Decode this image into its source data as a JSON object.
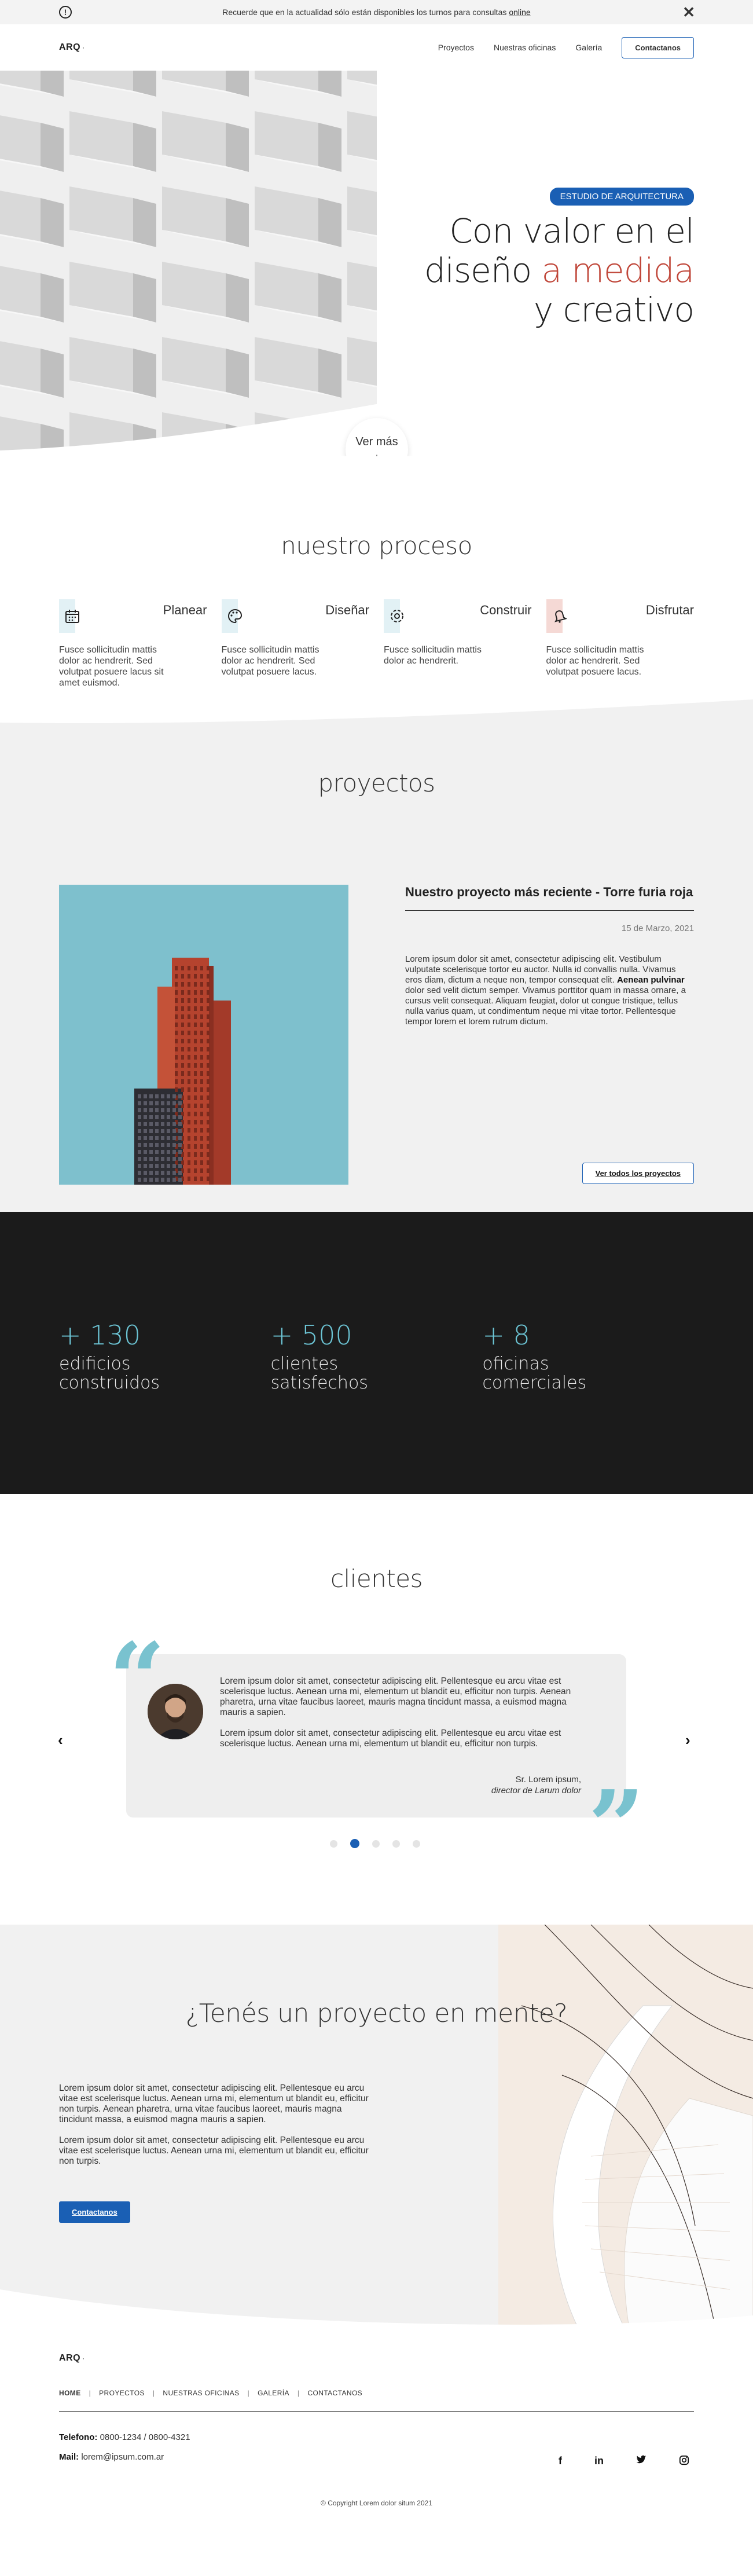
{
  "notice": {
    "icon": "alert-circle-icon",
    "text": "Recuerde que en la actualidad sólo están disponibles los turnos para consultas",
    "link": "online",
    "close": "✕"
  },
  "header": {
    "logo": "ARQ",
    "logo_mark": "·",
    "nav": [
      "Proyectos",
      "Nuestras oficinas",
      "Galería"
    ],
    "contact_button": "Contactanos"
  },
  "hero": {
    "tag": "ESTUDIO DE ARQUITECTURA",
    "line1": "Con valor en el",
    "line2_plain": "diseño",
    "line2_accent": "a medida",
    "line3": "y creativo",
    "scroll_label": "Ver más",
    "scroll_arrow": "↓"
  },
  "process": {
    "title": "nuestro proceso",
    "steps": [
      {
        "name": "Planear",
        "icon": "calendar-icon",
        "color": "#d9eef3",
        "desc": "Fusce sollicitudin mattis dolor ac hendrerit. Sed volutpat posuere lacus sit amet euismod."
      },
      {
        "name": "Diseñar",
        "icon": "palette-icon",
        "color": "#d9eef3",
        "desc": "Fusce sollicitudin mattis dolor ac hendrerit. Sed volutpat posuere lacus."
      },
      {
        "name": "Construir",
        "icon": "gear-icon",
        "color": "#d9eef3",
        "desc": "Fusce sollicitudin mattis dolor ac hendrerit."
      },
      {
        "name": "Disfrutar",
        "icon": "bell-icon",
        "color": "#f3d6d2",
        "desc": "Fusce sollicitudin mattis dolor ac hendrerit. Sed volutpat posuere lacus."
      }
    ]
  },
  "projects": {
    "title": "proyectos",
    "project_title": "Nuestro proyecto más reciente - Torre furia roja",
    "date": "15 de Marzo, 2021",
    "desc_a": "Lorem ipsum dolor sit amet, consectetur adipiscing elit. Vestibulum vulputate scelerisque tortor eu auctor. Nulla id convallis nulla. Vivamus eros diam, dictum a neque non, tempor consequat elit.",
    "desc_bold": "Aenean pulvinar",
    "desc_b": "dolor sed velit dictum semper. Vivamus porttitor quam in massa ornare, a cursus velit consequat. Aliquam feugiat, dolor ut congue tristique, tellus nulla varius quam, ut condimentum neque mi vitae tortor. Pellentesque tempor lorem et lorem rutrum dictum.",
    "button": "Ver todos los proyectos"
  },
  "stats": [
    {
      "number": "+ 130",
      "label": "edificios construidos"
    },
    {
      "number": "+ 500",
      "label": "clientes satisfechos"
    },
    {
      "number": "+ 8",
      "label": "oficinas comerciales"
    }
  ],
  "clients": {
    "title": "clientes",
    "prev": "‹",
    "next": "›",
    "quote_open": "“",
    "quote_close": "”",
    "paragraphs": [
      "Lorem ipsum dolor sit amet, consectetur adipiscing elit. Pellentesque eu arcu vitae est scelerisque luctus. Aenean urna mi, elementum ut blandit eu, efficitur non turpis. Aenean pharetra, urna vitae faucibus laoreet, mauris magna tincidunt massa, a euismod magna mauris a sapien.",
      "Lorem ipsum dolor sit amet, consectetur adipiscing elit. Pellentesque eu arcu vitae est scelerisque luctus. Aenean urna mi, elementum ut blandit eu, efficitur non turpis."
    ],
    "author_name": "Sr. Lorem ipsum,",
    "author_role": "director de Larum dolor",
    "dot_count": 5,
    "active_dot": 1
  },
  "cta": {
    "title": "¿Tenés un proyecto en mente?",
    "paragraphs": [
      "Lorem ipsum dolor sit amet, consectetur adipiscing elit. Pellentesque eu arcu vitae est scelerisque luctus. Aenean urna mi, elementum ut blandit eu, efficitur non turpis. Aenean pharetra, urna vitae faucibus laoreet, mauris magna tincidunt massa, a euismod magna mauris a sapien.",
      "Lorem ipsum dolor sit amet, consectetur adipiscing elit. Pellentesque eu arcu vitae est scelerisque luctus. Aenean urna mi, elementum ut blandit eu, efficitur non turpis."
    ],
    "button": "Contactanos"
  },
  "footer": {
    "logo": "ARQ",
    "logo_mark": "·",
    "nav": [
      "HOME",
      "PROYECTOS",
      "NUESTRAS OFICINAS",
      "GALERÍA",
      "CONTACTANOS"
    ],
    "phone_label": "Telefono:",
    "phone": "0800-1234 / 0800-4321",
    "mail_label": "Mail:",
    "mail": "lorem@ipsum.com.ar",
    "socials": [
      {
        "icon": "facebook-icon",
        "glyph": "f"
      },
      {
        "icon": "linkedin-icon",
        "glyph": "in"
      },
      {
        "icon": "twitter-icon",
        "glyph": "🐦"
      },
      {
        "icon": "instagram-icon",
        "glyph": "◎"
      }
    ],
    "copyright": "© Copyright Lorem dolor situm 2021"
  },
  "colors": {
    "brand_blue": "#1a5fb4",
    "accent_red": "#c0473a",
    "accent_cyan": "#6cc4d4",
    "dark": "#1b1b1b",
    "light_grey": "#f1f1f1"
  }
}
